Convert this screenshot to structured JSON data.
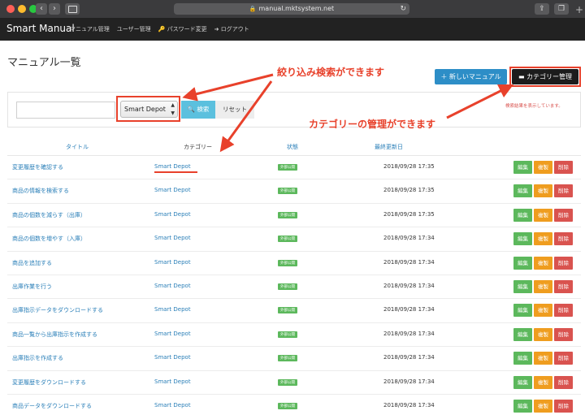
{
  "browser": {
    "url": "manual.mktsystem.net",
    "back_icon": "chevron-left-icon",
    "forward_icon": "chevron-right-icon"
  },
  "navbar": {
    "brand": "Smart Manual",
    "links": [
      "マニュアル管理",
      "ユーザー管理",
      "🔑 パスワード変更",
      "➜ ログアウト"
    ]
  },
  "page": {
    "title": "マニュアル一覧",
    "new_manual_button": "＋ 新しいマニュアル",
    "category_button": "▬ カテゴリー管理"
  },
  "search": {
    "input_value": "",
    "selected_category": "Smart Depot",
    "search_button": "🔍 検索",
    "reset_button": "リセット",
    "result_note": "検索結果を表示しています。"
  },
  "annotations": {
    "filter": "絞り込み検索ができます",
    "category": "カテゴリーの管理ができます"
  },
  "table": {
    "headers": {
      "title": "タイトル",
      "category": "カテゴリー",
      "status": "状態",
      "updated": "最終更新日"
    },
    "action_labels": {
      "edit": "編集",
      "copy": "複製",
      "delete": "削除"
    },
    "rows": [
      {
        "title": "変更履歴を確認する",
        "category": "Smart Depot",
        "status": "外部公開",
        "updated": "2018/09/28 17:35"
      },
      {
        "title": "商品の情報を検索する",
        "category": "Smart Depot",
        "status": "外部公開",
        "updated": "2018/09/28 17:35"
      },
      {
        "title": "商品の個数を減らす（出庫）",
        "category": "Smart Depot",
        "status": "外部公開",
        "updated": "2018/09/28 17:35"
      },
      {
        "title": "商品の個数を増やす（入庫）",
        "category": "Smart Depot",
        "status": "外部公開",
        "updated": "2018/09/28 17:34"
      },
      {
        "title": "商品を追加する",
        "category": "Smart Depot",
        "status": "外部公開",
        "updated": "2018/09/28 17:34"
      },
      {
        "title": "出庫作業を行う",
        "category": "Smart Depot",
        "status": "外部公開",
        "updated": "2018/09/28 17:34"
      },
      {
        "title": "出庫指示データをダウンロードする",
        "category": "Smart Depot",
        "status": "外部公開",
        "updated": "2018/09/28 17:34"
      },
      {
        "title": "商品一覧から出庫指示を作成する",
        "category": "Smart Depot",
        "status": "外部公開",
        "updated": "2018/09/28 17:34"
      },
      {
        "title": "出庫指示を作成する",
        "category": "Smart Depot",
        "status": "外部公開",
        "updated": "2018/09/28 17:34"
      },
      {
        "title": "変更履歴をダウンロードする",
        "category": "Smart Depot",
        "status": "外部公開",
        "updated": "2018/09/28 17:34"
      },
      {
        "title": "商品データをダウンロードする",
        "category": "Smart Depot",
        "status": "外部公開",
        "updated": "2018/09/28 17:34"
      }
    ]
  },
  "colors": {
    "accent_red": "#e8412b",
    "link_blue": "#2a7fb8",
    "edit_green": "#5cb85c",
    "copy_orange": "#ef9d1f",
    "delete_red": "#d9534f"
  }
}
